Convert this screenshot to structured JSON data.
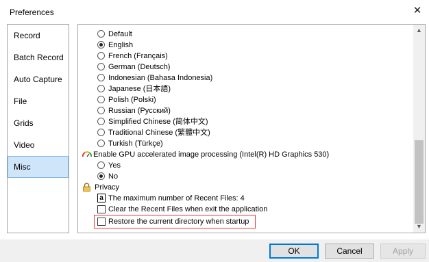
{
  "window": {
    "title": "Preferences"
  },
  "sidebar": {
    "items": [
      {
        "label": "Record"
      },
      {
        "label": "Batch Record"
      },
      {
        "label": "Auto Capture"
      },
      {
        "label": "File"
      },
      {
        "label": "Grids"
      },
      {
        "label": "Video"
      },
      {
        "label": "Misc"
      }
    ],
    "selected": "Misc"
  },
  "languages": {
    "options": [
      {
        "label": "Default",
        "selected": false
      },
      {
        "label": "English",
        "selected": true
      },
      {
        "label": "French (Français)",
        "selected": false
      },
      {
        "label": "German (Deutsch)",
        "selected": false
      },
      {
        "label": "Indonesian (Bahasa Indonesia)",
        "selected": false
      },
      {
        "label": "Japanese (日本語)",
        "selected": false
      },
      {
        "label": "Polish (Polski)",
        "selected": false
      },
      {
        "label": "Russian (Русский)",
        "selected": false
      },
      {
        "label": "Simplified Chinese (简体中文)",
        "selected": false
      },
      {
        "label": "Traditional Chinese (繁體中文)",
        "selected": false
      },
      {
        "label": "Turkish (Türkçe)",
        "selected": false
      }
    ]
  },
  "gpu": {
    "label": "Enable GPU accelerated image processing (Intel(R) HD Graphics 530)",
    "options": [
      {
        "label": "Yes",
        "selected": false
      },
      {
        "label": "No",
        "selected": true
      }
    ]
  },
  "privacy": {
    "label": "Privacy",
    "recent_files_label": "The maximum number of Recent Files: 4",
    "clear_recent_label": "Clear the Recent Files when exit the application",
    "clear_recent_checked": false,
    "restore_dir_label": "Restore the current directory when startup",
    "restore_dir_checked": false
  },
  "buttons": {
    "ok": "OK",
    "cancel": "Cancel",
    "apply": "Apply"
  },
  "colors": {
    "selected_bg": "#cfe5f9",
    "highlight_border": "#e53935",
    "primary_border": "#0078d7"
  },
  "icons": [
    "close-icon",
    "gauge-icon",
    "lock-icon",
    "a-letter-icon",
    "scroll-up-icon",
    "scroll-down-icon"
  ]
}
